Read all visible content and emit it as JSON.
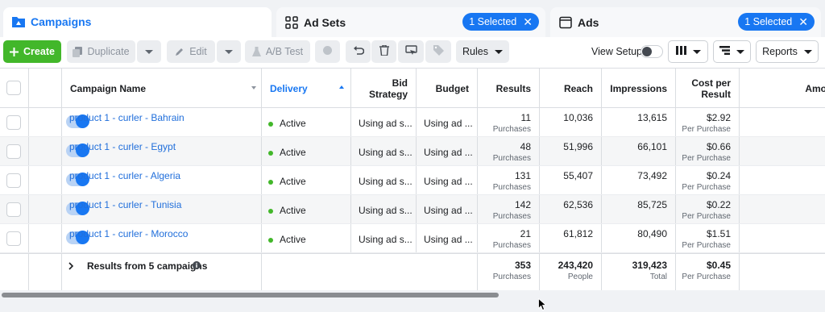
{
  "tabs": {
    "campaigns": {
      "label": "Campaigns"
    },
    "adsets": {
      "label": "Ad Sets",
      "selected": "1 Selected",
      "close": "✕"
    },
    "ads": {
      "label": "Ads",
      "selected": "1 Selected",
      "close": "✕"
    }
  },
  "toolbar": {
    "create": "Create",
    "duplicate": "Duplicate",
    "edit": "Edit",
    "abtest": "A/B Test",
    "rules": "Rules",
    "view_setup": "View Setup",
    "reports": "Reports"
  },
  "columns": {
    "name": "Campaign Name",
    "delivery": "Delivery",
    "bid": "Bid Strategy",
    "budget": "Budget",
    "results": "Results",
    "reach": "Reach",
    "impressions": "Impressions",
    "cpr": "Cost per Result",
    "amount": "Amo"
  },
  "rows": [
    {
      "name": "product 1 - curler - Bahrain",
      "delivery": "Active",
      "bid": "Using ad s...",
      "budget": "Using ad ...",
      "results": "11",
      "results_sub": "Purchases",
      "reach": "10,036",
      "impressions": "13,615",
      "cpr": "$2.92",
      "cpr_sub": "Per Purchase"
    },
    {
      "name": "product 1 - curler - Egypt",
      "delivery": "Active",
      "bid": "Using ad s...",
      "budget": "Using ad ...",
      "results": "48",
      "results_sub": "Purchases",
      "reach": "51,996",
      "impressions": "66,101",
      "cpr": "$0.66",
      "cpr_sub": "Per Purchase"
    },
    {
      "name": "product 1 - curler - Algeria",
      "delivery": "Active",
      "bid": "Using ad s...",
      "budget": "Using ad ...",
      "results": "131",
      "results_sub": "Purchases",
      "reach": "55,407",
      "impressions": "73,492",
      "cpr": "$0.24",
      "cpr_sub": "Per Purchase"
    },
    {
      "name": "product 1 - curler - Tunisia",
      "delivery": "Active",
      "bid": "Using ad s...",
      "budget": "Using ad ...",
      "results": "142",
      "results_sub": "Purchases",
      "reach": "62,536",
      "impressions": "85,725",
      "cpr": "$0.22",
      "cpr_sub": "Per Purchase"
    },
    {
      "name": "product 1 - curler - Morocco",
      "delivery": "Active",
      "bid": "Using ad s...",
      "budget": "Using ad ...",
      "results": "21",
      "results_sub": "Purchases",
      "reach": "61,812",
      "impressions": "80,490",
      "cpr": "$1.51",
      "cpr_sub": "Per Purchase"
    }
  ],
  "totals": {
    "label": "Results from 5 campaigns",
    "results": "353",
    "results_sub": "Purchases",
    "reach": "243,420",
    "reach_sub": "People",
    "impressions": "319,423",
    "impressions_sub": "Total",
    "cpr": "$0.45",
    "cpr_sub": "Per Purchase"
  },
  "colors": {
    "accent": "#1877f2",
    "create": "#42b72a",
    "active_dot": "#42b72a",
    "link": "#216fdb"
  },
  "icons": [
    "campaigns-icon",
    "adsets-grid-icon",
    "ads-window-icon",
    "plus-icon",
    "duplicate-icon",
    "pencil-icon",
    "flask-icon",
    "undo-icon",
    "trash-icon",
    "preview-icon",
    "tag-icon",
    "columns-icon",
    "breakdown-icon",
    "info-icon",
    "chevron-right-icon",
    "sort-icon",
    "cursor-icon"
  ]
}
